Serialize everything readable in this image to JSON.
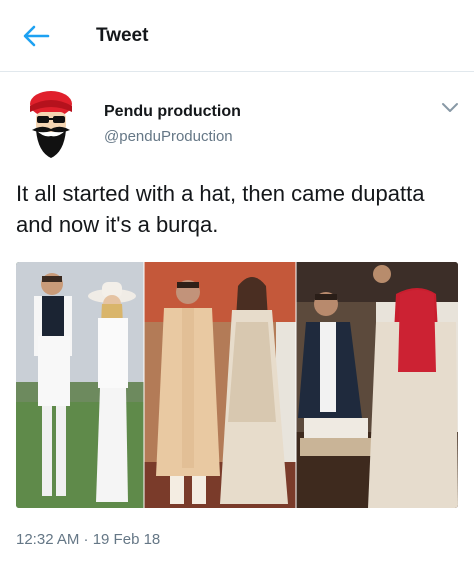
{
  "header": {
    "title": "Tweet",
    "back_icon": "arrow-left-icon",
    "accent": "#1da1f2"
  },
  "tweet": {
    "author_name": "Pendu production",
    "author_handle": "@penduProduction",
    "text": "It all started with a hat, then came dupatta and now it's a burqa.",
    "timestamp": "12:32 AM · 19 Feb 18",
    "menu_icon": "chevron-down-icon",
    "avatar_icon": "turban-mustache-avatar"
  },
  "media": {
    "panels": [
      "photo-white-outfit-couple",
      "photo-wedding-couple",
      "photo-seated-couple-veiled"
    ]
  }
}
